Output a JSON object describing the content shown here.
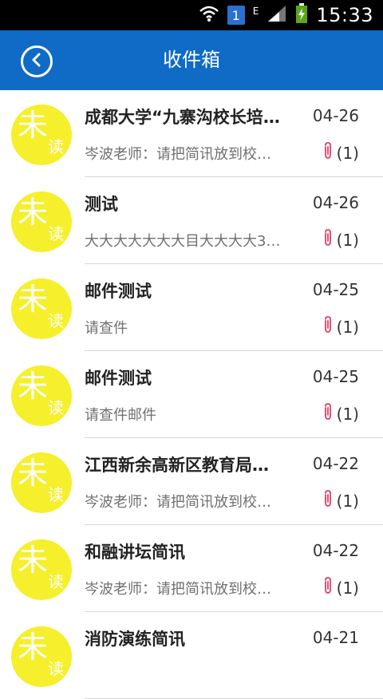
{
  "status_bar": {
    "time": "15:33",
    "notification_badge": "1",
    "network_type": "E",
    "icons": [
      "wifi-icon",
      "signal-icon",
      "battery-charging-icon"
    ]
  },
  "header": {
    "title": "收件箱",
    "back_icon": "back-icon"
  },
  "colors": {
    "app_bar": "#0f6bc6",
    "avatar": "#f6ef2b",
    "attachment_icon": "#e23c6b"
  },
  "messages": [
    {
      "status_big": "未",
      "status_small": "读",
      "subject": "成都大学“九寨沟校长培训…",
      "date": "04-26",
      "preview": "岑波老师：请把简讯放到校…",
      "attachment_count": "(1)"
    },
    {
      "status_big": "未",
      "status_small": "读",
      "subject": "测试",
      "date": "04-26",
      "preview": "大大大大大大大目大大大大3…",
      "attachment_count": "(1)"
    },
    {
      "status_big": "未",
      "status_small": "读",
      "subject": "邮件测试",
      "date": "04-25",
      "preview": "请查件",
      "attachment_count": "(1)"
    },
    {
      "status_big": "未",
      "status_small": "读",
      "subject": "邮件测试",
      "date": "04-25",
      "preview": "请查件邮件",
      "attachment_count": "(1)"
    },
    {
      "status_big": "未",
      "status_small": "读",
      "subject": "江西新余高新区教育局…",
      "date": "04-22",
      "preview": "岑波老师：请把简讯放到校…",
      "attachment_count": "(1)"
    },
    {
      "status_big": "未",
      "status_small": "读",
      "subject": "和融讲坛简讯",
      "date": "04-22",
      "preview": "岑波老师：请把简讯放到校…",
      "attachment_count": "(1)"
    },
    {
      "status_big": "未",
      "status_small": "读",
      "subject": "消防演练简讯",
      "date": "04-21",
      "preview": "",
      "attachment_count": ""
    }
  ]
}
